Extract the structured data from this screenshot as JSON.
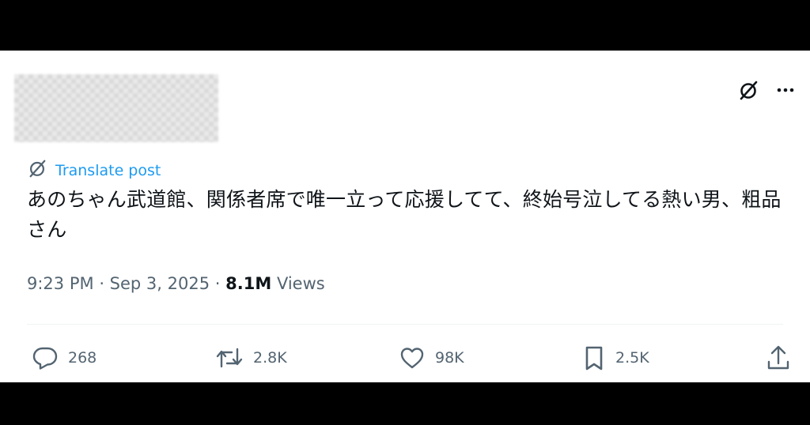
{
  "post": {
    "translate_label": "Translate post",
    "text": "あのちゃん武道館、関係者席で唯一立って応援してて、終始号泣してる熱い男、粗品さん",
    "time": "9:23 PM",
    "date": "Sep 3, 2025",
    "views_count": "8.1M",
    "views_label": "Views"
  },
  "actions": {
    "replies": "268",
    "reposts": "2.8K",
    "likes": "98K",
    "bookmarks": "2.5K"
  },
  "icons": [
    "grok-icon",
    "more-icon",
    "translate-icon",
    "reply-icon",
    "repost-icon",
    "like-icon",
    "bookmark-icon",
    "share-icon"
  ],
  "colors": {
    "accent": "#1d9bf0",
    "text": "#0f1419",
    "secondary": "#536471"
  }
}
